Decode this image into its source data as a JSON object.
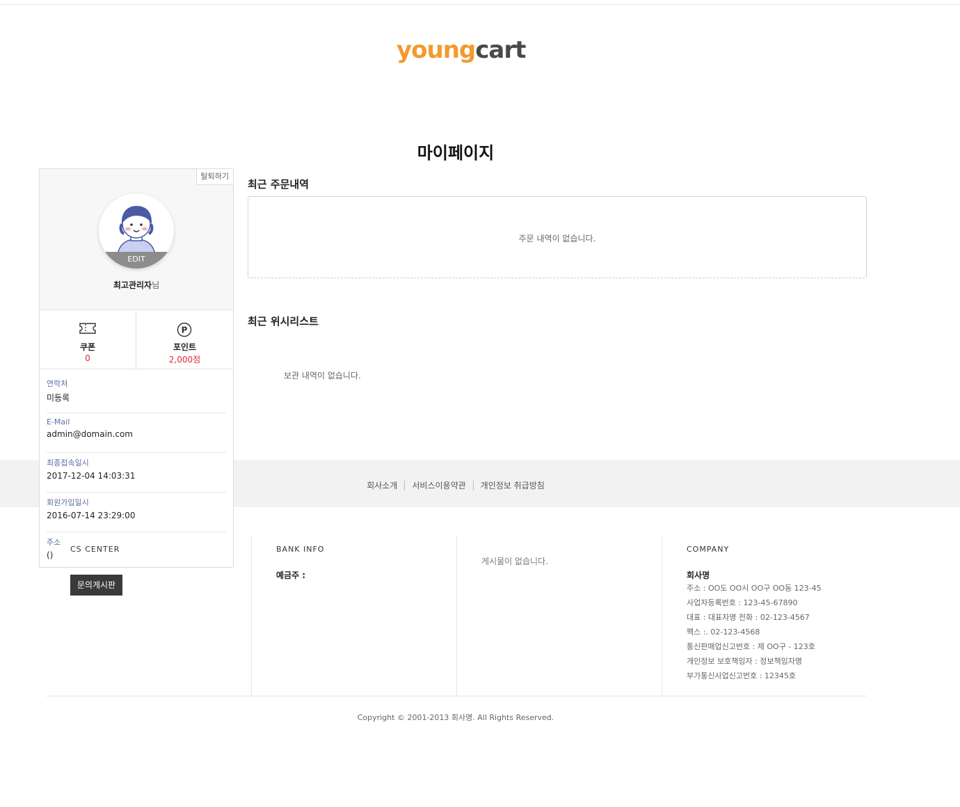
{
  "brand": {
    "logo_part1": "young",
    "logo_part2": "cart"
  },
  "page_title": "마이페이지",
  "sidebar": {
    "withdraw_label": "탈퇴하기",
    "edit_label": "EDIT",
    "nickname": "최고관리자",
    "nickname_suffix": "님",
    "coupon": {
      "label": "쿠폰",
      "value": "0",
      "icon": "ticket-icon"
    },
    "point": {
      "label": "포인트",
      "value": "2,000점",
      "icon": "point-icon"
    },
    "info": [
      {
        "key": "연락처",
        "value": "미등록"
      },
      {
        "key": "E-Mail",
        "value": "admin@domain.com"
      },
      {
        "key": "최종접속일시",
        "value": "2017-12-04 14:03:31"
      },
      {
        "key": "회원가입일시",
        "value": "2016-07-14 23:29:00"
      },
      {
        "key": "주소",
        "value": "()"
      }
    ]
  },
  "orders": {
    "title": "최근 주문내역",
    "empty": "주문 내역이 없습니다."
  },
  "wishlist": {
    "title": "최근 위시리스트",
    "empty": "보관 내역이 없습니다."
  },
  "footer": {
    "links": [
      "회사소개",
      "서비스이용약관",
      "개인정보 취급방침"
    ],
    "cs": {
      "title": "CS CENTER",
      "button": "문의게시판"
    },
    "bank": {
      "title": "BANK INFO",
      "holder": "예금주 :"
    },
    "board": {
      "empty": "게시물이 없습니다."
    },
    "company": {
      "title": "COMPANY",
      "name": "회사명",
      "lines": [
        "주소 : OO도 OO시 OO구 OO동 123-45",
        "사업자등록번호 : 123-45-67890",
        "대표 : 대표자명   전화 : 02-123-4567",
        "팩스 :. 02-123-4568",
        "통신판매업신고번호 : 제 OO구 - 123호",
        "개인정보 보호책임자 : 정보책임자명",
        "부가통신사업신고번호 : 12345호"
      ]
    },
    "copyright": "Copyright © 2001-2013 회사명. All Rights Reserved."
  },
  "colors": {
    "accent": "#f29a2e",
    "point_value": "#e0283d",
    "label_blue": "#5a6ea6"
  }
}
